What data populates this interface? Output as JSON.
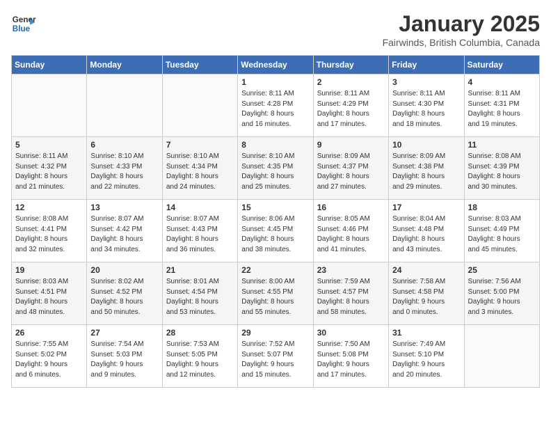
{
  "header": {
    "logo_line1": "General",
    "logo_line2": "Blue",
    "month": "January 2025",
    "location": "Fairwinds, British Columbia, Canada"
  },
  "days_of_week": [
    "Sunday",
    "Monday",
    "Tuesday",
    "Wednesday",
    "Thursday",
    "Friday",
    "Saturday"
  ],
  "weeks": [
    [
      {
        "day": "",
        "info": ""
      },
      {
        "day": "",
        "info": ""
      },
      {
        "day": "",
        "info": ""
      },
      {
        "day": "1",
        "info": "Sunrise: 8:11 AM\nSunset: 4:28 PM\nDaylight: 8 hours\nand 16 minutes."
      },
      {
        "day": "2",
        "info": "Sunrise: 8:11 AM\nSunset: 4:29 PM\nDaylight: 8 hours\nand 17 minutes."
      },
      {
        "day": "3",
        "info": "Sunrise: 8:11 AM\nSunset: 4:30 PM\nDaylight: 8 hours\nand 18 minutes."
      },
      {
        "day": "4",
        "info": "Sunrise: 8:11 AM\nSunset: 4:31 PM\nDaylight: 8 hours\nand 19 minutes."
      }
    ],
    [
      {
        "day": "5",
        "info": "Sunrise: 8:11 AM\nSunset: 4:32 PM\nDaylight: 8 hours\nand 21 minutes."
      },
      {
        "day": "6",
        "info": "Sunrise: 8:10 AM\nSunset: 4:33 PM\nDaylight: 8 hours\nand 22 minutes."
      },
      {
        "day": "7",
        "info": "Sunrise: 8:10 AM\nSunset: 4:34 PM\nDaylight: 8 hours\nand 24 minutes."
      },
      {
        "day": "8",
        "info": "Sunrise: 8:10 AM\nSunset: 4:35 PM\nDaylight: 8 hours\nand 25 minutes."
      },
      {
        "day": "9",
        "info": "Sunrise: 8:09 AM\nSunset: 4:37 PM\nDaylight: 8 hours\nand 27 minutes."
      },
      {
        "day": "10",
        "info": "Sunrise: 8:09 AM\nSunset: 4:38 PM\nDaylight: 8 hours\nand 29 minutes."
      },
      {
        "day": "11",
        "info": "Sunrise: 8:08 AM\nSunset: 4:39 PM\nDaylight: 8 hours\nand 30 minutes."
      }
    ],
    [
      {
        "day": "12",
        "info": "Sunrise: 8:08 AM\nSunset: 4:41 PM\nDaylight: 8 hours\nand 32 minutes."
      },
      {
        "day": "13",
        "info": "Sunrise: 8:07 AM\nSunset: 4:42 PM\nDaylight: 8 hours\nand 34 minutes."
      },
      {
        "day": "14",
        "info": "Sunrise: 8:07 AM\nSunset: 4:43 PM\nDaylight: 8 hours\nand 36 minutes."
      },
      {
        "day": "15",
        "info": "Sunrise: 8:06 AM\nSunset: 4:45 PM\nDaylight: 8 hours\nand 38 minutes."
      },
      {
        "day": "16",
        "info": "Sunrise: 8:05 AM\nSunset: 4:46 PM\nDaylight: 8 hours\nand 41 minutes."
      },
      {
        "day": "17",
        "info": "Sunrise: 8:04 AM\nSunset: 4:48 PM\nDaylight: 8 hours\nand 43 minutes."
      },
      {
        "day": "18",
        "info": "Sunrise: 8:03 AM\nSunset: 4:49 PM\nDaylight: 8 hours\nand 45 minutes."
      }
    ],
    [
      {
        "day": "19",
        "info": "Sunrise: 8:03 AM\nSunset: 4:51 PM\nDaylight: 8 hours\nand 48 minutes."
      },
      {
        "day": "20",
        "info": "Sunrise: 8:02 AM\nSunset: 4:52 PM\nDaylight: 8 hours\nand 50 minutes."
      },
      {
        "day": "21",
        "info": "Sunrise: 8:01 AM\nSunset: 4:54 PM\nDaylight: 8 hours\nand 53 minutes."
      },
      {
        "day": "22",
        "info": "Sunrise: 8:00 AM\nSunset: 4:55 PM\nDaylight: 8 hours\nand 55 minutes."
      },
      {
        "day": "23",
        "info": "Sunrise: 7:59 AM\nSunset: 4:57 PM\nDaylight: 8 hours\nand 58 minutes."
      },
      {
        "day": "24",
        "info": "Sunrise: 7:58 AM\nSunset: 4:58 PM\nDaylight: 9 hours\nand 0 minutes."
      },
      {
        "day": "25",
        "info": "Sunrise: 7:56 AM\nSunset: 5:00 PM\nDaylight: 9 hours\nand 3 minutes."
      }
    ],
    [
      {
        "day": "26",
        "info": "Sunrise: 7:55 AM\nSunset: 5:02 PM\nDaylight: 9 hours\nand 6 minutes."
      },
      {
        "day": "27",
        "info": "Sunrise: 7:54 AM\nSunset: 5:03 PM\nDaylight: 9 hours\nand 9 minutes."
      },
      {
        "day": "28",
        "info": "Sunrise: 7:53 AM\nSunset: 5:05 PM\nDaylight: 9 hours\nand 12 minutes."
      },
      {
        "day": "29",
        "info": "Sunrise: 7:52 AM\nSunset: 5:07 PM\nDaylight: 9 hours\nand 15 minutes."
      },
      {
        "day": "30",
        "info": "Sunrise: 7:50 AM\nSunset: 5:08 PM\nDaylight: 9 hours\nand 17 minutes."
      },
      {
        "day": "31",
        "info": "Sunrise: 7:49 AM\nSunset: 5:10 PM\nDaylight: 9 hours\nand 20 minutes."
      },
      {
        "day": "",
        "info": ""
      }
    ]
  ]
}
